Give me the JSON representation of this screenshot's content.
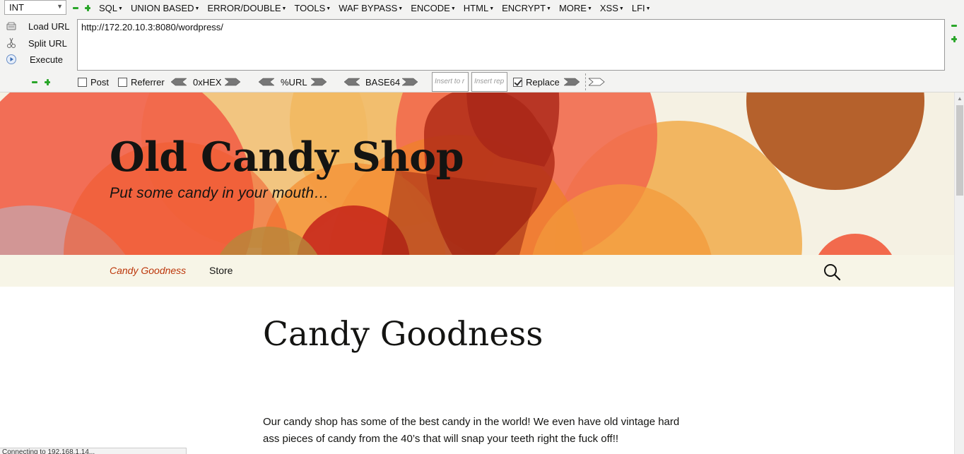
{
  "hackbar": {
    "type_select": "INT",
    "menus": [
      "SQL",
      "UNION BASED",
      "ERROR/DOUBLE",
      "TOOLS",
      "WAF BYPASS",
      "ENCODE",
      "HTML",
      "ENCRYPT",
      "MORE",
      "XSS",
      "LFI"
    ],
    "load_url": "Load URL",
    "split_url": "Split URL",
    "execute": "Execute",
    "url": "http://172.20.10.3:8080/wordpress/",
    "post_label": "Post",
    "referrer_label": "Referrer",
    "hex_label": "0xHEX",
    "url_enc_label": "%URL",
    "base64_label": "BASE64",
    "insert_to_placeholder": "Insert to r",
    "insert_replace_placeholder": "Insert rep",
    "replace_label": "Replace",
    "post_checked": false,
    "referrer_checked": false,
    "replace_checked": true
  },
  "site": {
    "title": "Old Candy Shop",
    "description": "Put some candy in your mouth…",
    "nav": [
      {
        "label": "Candy Goodness",
        "active": true
      },
      {
        "label": "Store",
        "active": false
      }
    ],
    "page_heading": "Candy Goodness",
    "body_text": "Our candy shop has some of the best candy in the world! We even have old vintage hard ass pieces of candy from the 40’s that will snap your teeth right the fuck off!!"
  },
  "status_bar": "Connecting to 192.168.1.14...",
  "colors": {
    "accent_nav": "#bc360a",
    "header_bg": "#f5f1e3",
    "nav_bg": "#f7f5e7",
    "icon_green": "#2aa62a"
  }
}
